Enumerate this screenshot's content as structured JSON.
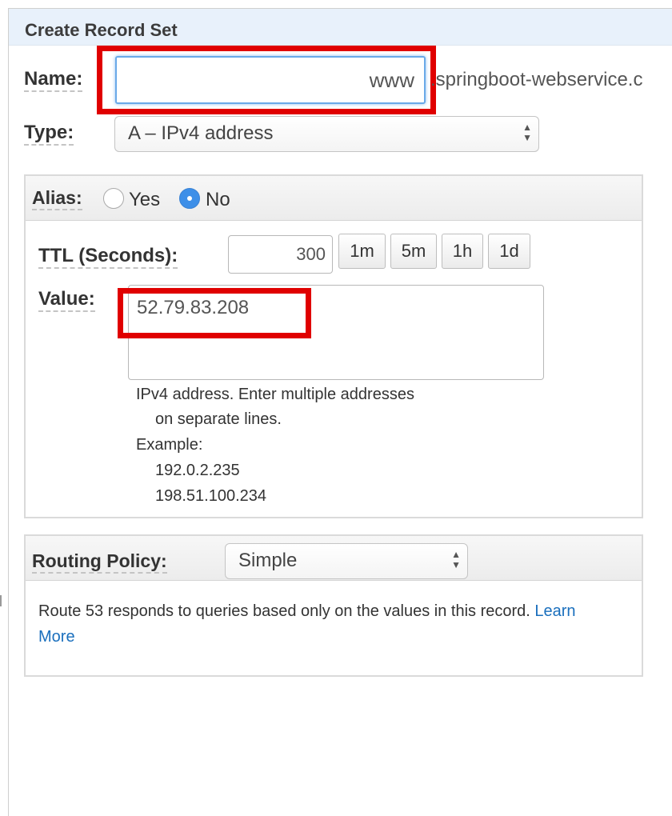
{
  "panel": {
    "title": "Create Record Set"
  },
  "name": {
    "label": "Name:",
    "value": "www",
    "domain_suffix": ".springboot-webservice.c"
  },
  "type": {
    "label": "Type:",
    "selected": "A – IPv4 address"
  },
  "alias": {
    "label": "Alias:",
    "yes_label": "Yes",
    "no_label": "No",
    "selected": "No"
  },
  "ttl": {
    "label": "TTL (Seconds):",
    "value": "300",
    "presets": [
      "1m",
      "5m",
      "1h",
      "1d"
    ]
  },
  "value": {
    "label": "Value:",
    "content": "52.79.83.208",
    "help_line1": "IPv4 address. Enter multiple addresses",
    "help_line2": "on separate lines.",
    "example_label": "Example:",
    "examples": [
      "192.0.2.235",
      "198.51.100.234"
    ]
  },
  "routing": {
    "label": "Routing Policy:",
    "selected": "Simple",
    "description": "Route 53 responds to queries based only on the values in this record.",
    "learn_link": "Learn",
    "more_link": "More"
  },
  "colors": {
    "header_bg": "#e8f1fb",
    "highlight": "#e00000",
    "focus": "#6aa9e8",
    "link": "#1a6fbd",
    "radio_selected": "#3d8fe8"
  }
}
